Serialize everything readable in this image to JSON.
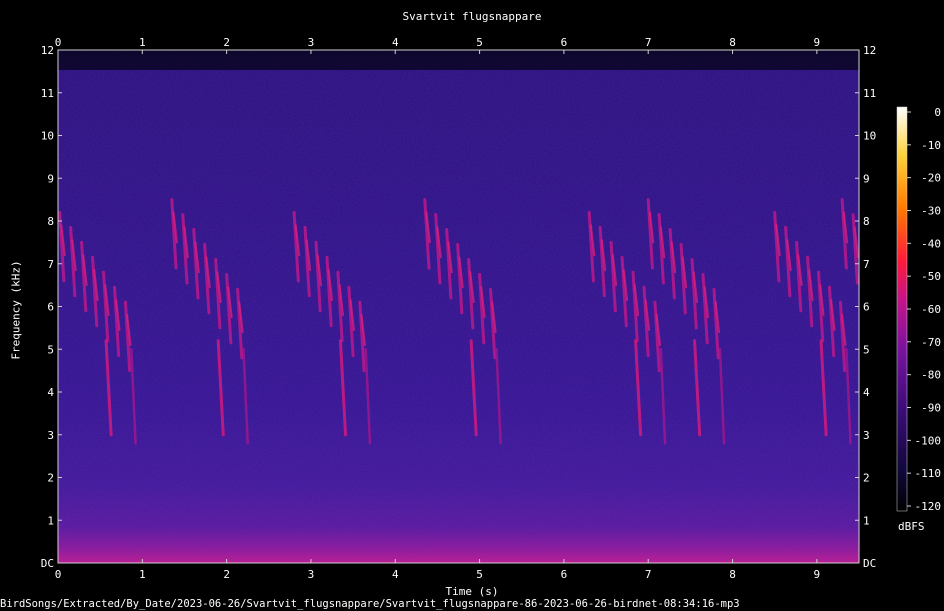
{
  "chart_data": {
    "type": "heatmap",
    "title": "Svartvit flugsnappare",
    "xlabel": "Time (s)",
    "ylabel": "Frequency (kHz)",
    "x_ticks": [
      "0",
      "1",
      "2",
      "3",
      "4",
      "5",
      "6",
      "7",
      "8",
      "9"
    ],
    "y_ticks": [
      "DC",
      "1",
      "2",
      "3",
      "4",
      "5",
      "6",
      "7",
      "8",
      "9",
      "10",
      "11",
      "12"
    ],
    "xlim": [
      0,
      9.5
    ],
    "ylim": [
      0,
      12
    ],
    "colorbar": {
      "label": "dBFS",
      "ticks": [
        "0",
        "-10",
        "-20",
        "-30",
        "-40",
        "-50",
        "-60",
        "-70",
        "-80",
        "-90",
        "-100",
        "-110",
        "-120"
      ],
      "range": [
        -120,
        0
      ],
      "colors": [
        "#000000",
        "#10083a",
        "#3a0c78",
        "#7a12a0",
        "#c4148a",
        "#ff1a3a",
        "#ff7a00",
        "#ffd23a",
        "#ffffff"
      ]
    },
    "song_phrases_start_s": [
      0.02,
      1.35,
      2.8,
      4.35,
      6.3,
      7.0,
      8.5,
      9.3
    ]
  },
  "footer": "BirdSongs/Extracted/By_Date/2023-06-26/Svartvit_flugsnappare/Svartvit_flugsnappare-86-2023-06-26-birdnet-08:34:16-mp3"
}
